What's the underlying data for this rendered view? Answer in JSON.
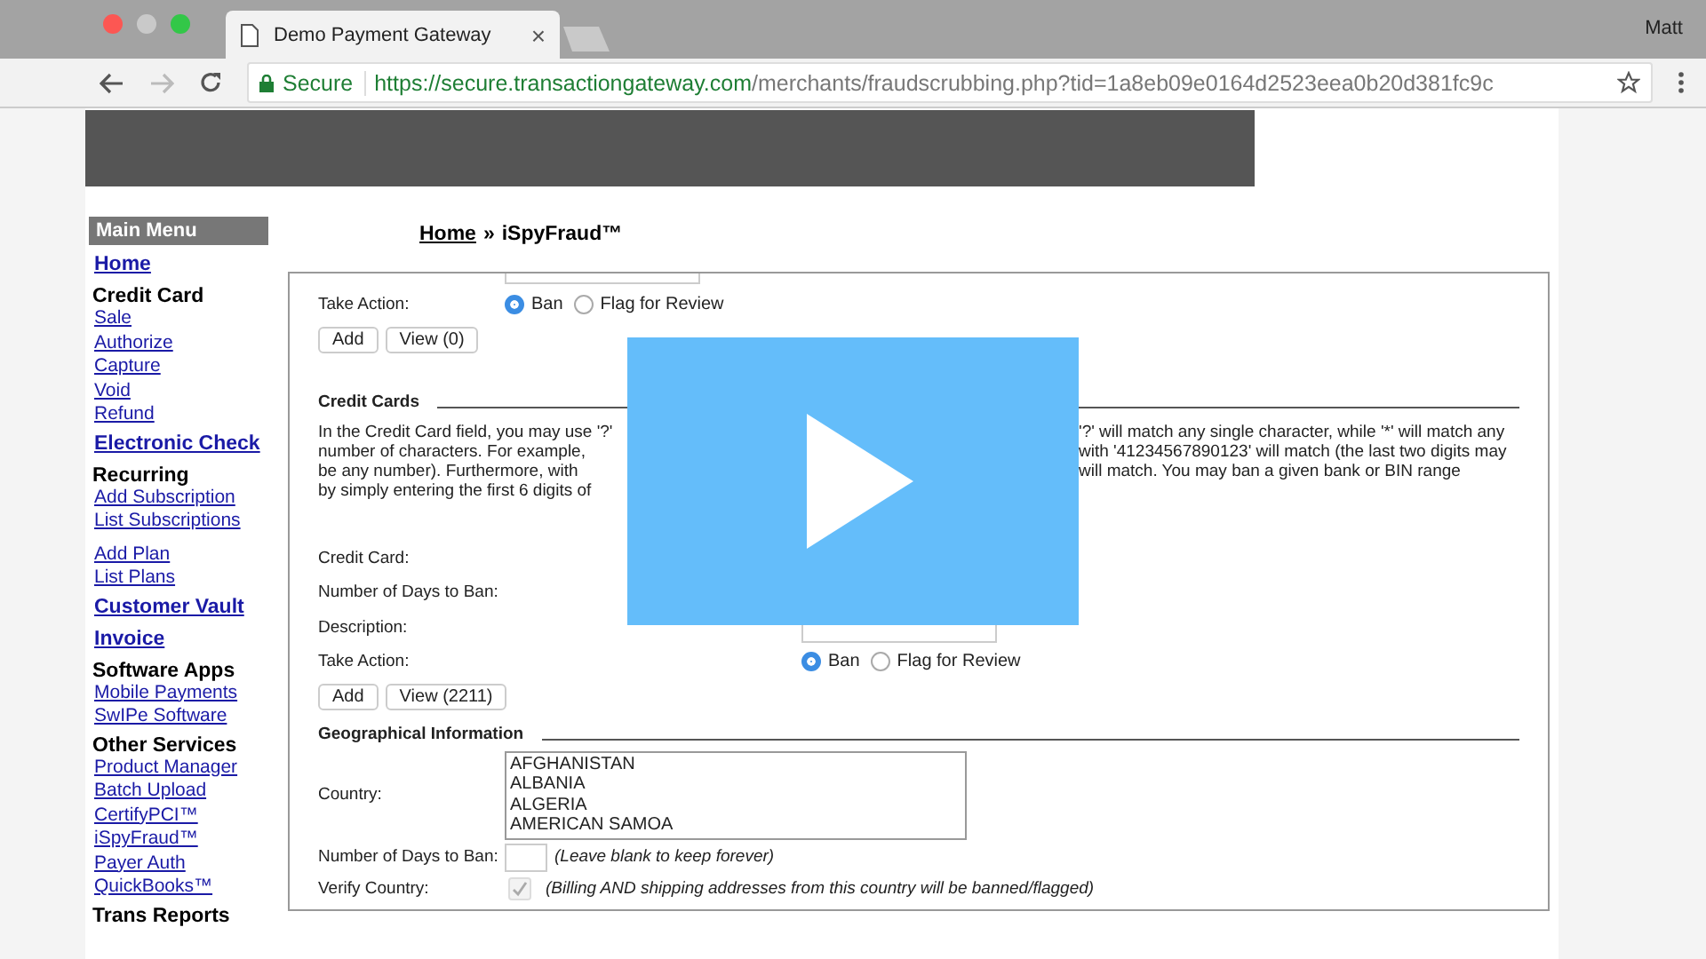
{
  "browser": {
    "tab": {
      "title": "Demo Payment Gateway",
      "close": "×"
    },
    "user": "Matt",
    "secure_label": "Secure",
    "url_host": "https://secure.transactiongateway.com",
    "url_path": "/merchants/fraudscrubbing.php?tid=1a8eb09e0164d2523eea0b20d381fc9c"
  },
  "sidebar": [
    {
      "kind": "header",
      "label": "Main Menu"
    },
    {
      "kind": "main-link",
      "label": "Home"
    },
    {
      "kind": "section",
      "label": "Credit Card"
    },
    {
      "kind": "link",
      "label": "Sale"
    },
    {
      "kind": "link",
      "label": "Authorize"
    },
    {
      "kind": "link",
      "label": "Capture"
    },
    {
      "kind": "link",
      "label": "Void"
    },
    {
      "kind": "link",
      "label": "Refund"
    },
    {
      "kind": "main-link",
      "label": "Electronic Check"
    },
    {
      "kind": "section",
      "label": "Recurring"
    },
    {
      "kind": "link",
      "label": "Add Subscription"
    },
    {
      "kind": "link",
      "label": "List Subscriptions"
    },
    {
      "kind": "spaced-link",
      "label": "Add Plan"
    },
    {
      "kind": "link",
      "label": "List Plans"
    },
    {
      "kind": "main-link",
      "label": "Customer Vault"
    },
    {
      "kind": "main-link",
      "label": "Invoice"
    },
    {
      "kind": "section",
      "label": "Software Apps"
    },
    {
      "kind": "link",
      "label": "Mobile Payments"
    },
    {
      "kind": "link",
      "label": "SwIPe Software"
    },
    {
      "kind": "section",
      "label": "Other Services"
    },
    {
      "kind": "link",
      "label": "Product Manager"
    },
    {
      "kind": "link",
      "label": "Batch Upload"
    },
    {
      "kind": "link",
      "label": "CertifyPCI™"
    },
    {
      "kind": "link",
      "label": "iSpyFraud™"
    },
    {
      "kind": "link",
      "label": "Payer Auth"
    },
    {
      "kind": "link",
      "label": "QuickBooks™"
    },
    {
      "kind": "section",
      "label": "Trans Reports"
    }
  ],
  "breadcrumb": {
    "home": "Home",
    "separator": "»",
    "current": "iSpyFraud™"
  },
  "sections": [
    {
      "kind": "partial",
      "rows": [
        {
          "kind": "cut-field"
        },
        {
          "kind": "radio",
          "label": "Take Action:",
          "options": [
            {
              "label": "Ban",
              "selected": true
            },
            {
              "label": "Flag for Review",
              "selected": false
            }
          ]
        }
      ],
      "buttons": [
        "Add",
        "View (0)"
      ]
    },
    {
      "kind": "wide",
      "title": "Credit Cards",
      "paragraph": [
        {
          "left": "In the Credit Card field, you may use '?'",
          "right": "'?' will match any single character, while '*' will match any"
        },
        {
          "left": "number of characters. For example,",
          "right": "with '41234567890123' will match (the last two digits may"
        },
        {
          "left": "be any number). Furthermore, with",
          "right": "will match. You may ban a given bank or BIN range"
        },
        {
          "left": "by simply entering the first 6 digits of"
        }
      ],
      "rows": [
        {
          "kind": "label",
          "label": "Credit Card:"
        },
        {
          "kind": "label",
          "label": "Number of Days to Ban:"
        },
        {
          "kind": "field",
          "label": "Description:"
        },
        {
          "kind": "radio",
          "label": "Take Action:",
          "options": [
            {
              "label": "Ban",
              "selected": true
            },
            {
              "label": "Flag for Review",
              "selected": false
            }
          ]
        }
      ],
      "buttons": [
        "Add",
        "View (2211)"
      ]
    },
    {
      "kind": "narrow",
      "title": "Geographical Information",
      "rows": [
        {
          "kind": "list",
          "label": "Country:",
          "options": [
            "AFGHANISTAN",
            "ALBANIA",
            "ALGERIA",
            "AMERICAN SAMOA"
          ]
        },
        {
          "kind": "field",
          "label": "Number of Days to Ban:",
          "note": "(Leave blank to keep forever)"
        },
        {
          "kind": "check",
          "label": "Verify Country:",
          "checked": true,
          "note": "(Billing AND shipping addresses from this country will be banned/flagged)"
        }
      ]
    }
  ]
}
